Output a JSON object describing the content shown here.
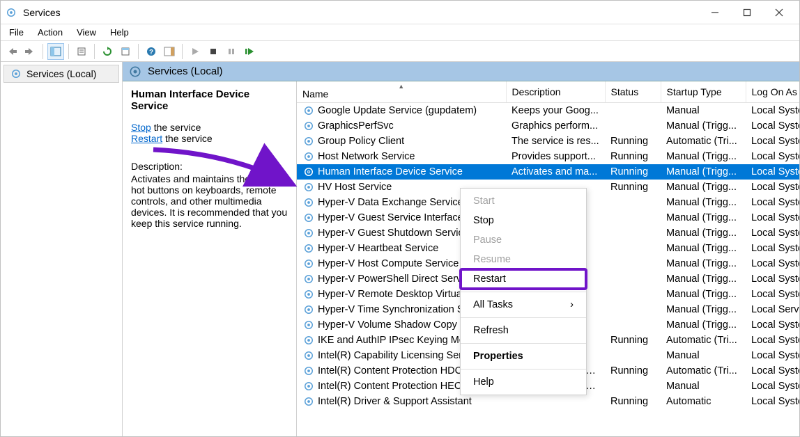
{
  "window": {
    "title": "Services"
  },
  "menus": [
    "File",
    "Action",
    "View",
    "Help"
  ],
  "tree": {
    "root": "Services (Local)"
  },
  "mainHeader": "Services (Local)",
  "detail": {
    "heading": "Human Interface Device Service",
    "stopLink": "Stop",
    "stopRest": " the service",
    "restartLink": "Restart",
    "restartRest": " the service",
    "descLabel": "Description:",
    "descText": "Activates and maintains the use of hot buttons on keyboards, remote controls, and other multimedia devices. It is recommended that you keep this service running."
  },
  "columns": {
    "name": "Name",
    "desc": "Description",
    "status": "Status",
    "startup": "Startup Type",
    "logon": "Log On As"
  },
  "rows": [
    {
      "n": "Google Update Service (gupdatem)",
      "d": "Keeps your Goog...",
      "s": "",
      "t": "Manual",
      "l": "Local System"
    },
    {
      "n": "GraphicsPerfSvc",
      "d": "Graphics perform...",
      "s": "",
      "t": "Manual (Trigg...",
      "l": "Local System"
    },
    {
      "n": "Group Policy Client",
      "d": "The service is res...",
      "s": "Running",
      "t": "Automatic (Tri...",
      "l": "Local System"
    },
    {
      "n": "Host Network Service",
      "d": "Provides support...",
      "s": "Running",
      "t": "Manual (Trigg...",
      "l": "Local System"
    },
    {
      "n": "Human Interface Device Service",
      "d": "Activates and ma...",
      "s": "Running",
      "t": "Manual (Trigg...",
      "l": "Local System",
      "sel": true
    },
    {
      "n": "HV Host Service",
      "d": "",
      "s": "Running",
      "t": "Manual (Trigg...",
      "l": "Local System"
    },
    {
      "n": "Hyper-V Data Exchange Service",
      "d": "",
      "s": "",
      "t": "Manual (Trigg...",
      "l": "Local System"
    },
    {
      "n": "Hyper-V Guest Service Interface",
      "d": "",
      "s": "",
      "t": "Manual (Trigg...",
      "l": "Local System"
    },
    {
      "n": "Hyper-V Guest Shutdown Service",
      "d": "",
      "s": "",
      "t": "Manual (Trigg...",
      "l": "Local System"
    },
    {
      "n": "Hyper-V Heartbeat Service",
      "d": "",
      "s": "",
      "t": "Manual (Trigg...",
      "l": "Local System"
    },
    {
      "n": "Hyper-V Host Compute Service",
      "d": "",
      "s": "",
      "t": "Manual (Trigg...",
      "l": "Local System"
    },
    {
      "n": "Hyper-V PowerShell Direct Service",
      "d": "",
      "s": "",
      "t": "Manual (Trigg...",
      "l": "Local System"
    },
    {
      "n": "Hyper-V Remote Desktop Virtual...",
      "d": "",
      "s": "",
      "t": "Manual (Trigg...",
      "l": "Local System"
    },
    {
      "n": "Hyper-V Time Synchronization Se...",
      "d": "",
      "s": "",
      "t": "Manual (Trigg...",
      "l": "Local Service"
    },
    {
      "n": "Hyper-V Volume Shadow Copy Re...",
      "d": "",
      "s": "",
      "t": "Manual (Trigg...",
      "l": "Local System"
    },
    {
      "n": "IKE and AuthIP IPsec Keying Mod...",
      "d": "",
      "s": "Running",
      "t": "Automatic (Tri...",
      "l": "Local System"
    },
    {
      "n": "Intel(R) Capability Licensing Servi...",
      "d": "",
      "s": "",
      "t": "Manual",
      "l": "Local System"
    },
    {
      "n": "Intel(R) Content Protection HDCP Service",
      "d": "Intel(R) Content P...",
      "s": "Running",
      "t": "Automatic (Tri...",
      "l": "Local System"
    },
    {
      "n": "Intel(R) Content Protection HECI Service",
      "d": "Intel(R) Content P...",
      "s": "",
      "t": "Manual",
      "l": "Local System"
    },
    {
      "n": "Intel(R) Driver & Support Assistant",
      "d": "",
      "s": "Running",
      "t": "Automatic",
      "l": "Local System"
    }
  ],
  "context": {
    "start": "Start",
    "stop": "Stop",
    "pause": "Pause",
    "resume": "Resume",
    "restart": "Restart",
    "alltasks": "All Tasks",
    "refresh": "Refresh",
    "properties": "Properties",
    "help": "Help"
  }
}
